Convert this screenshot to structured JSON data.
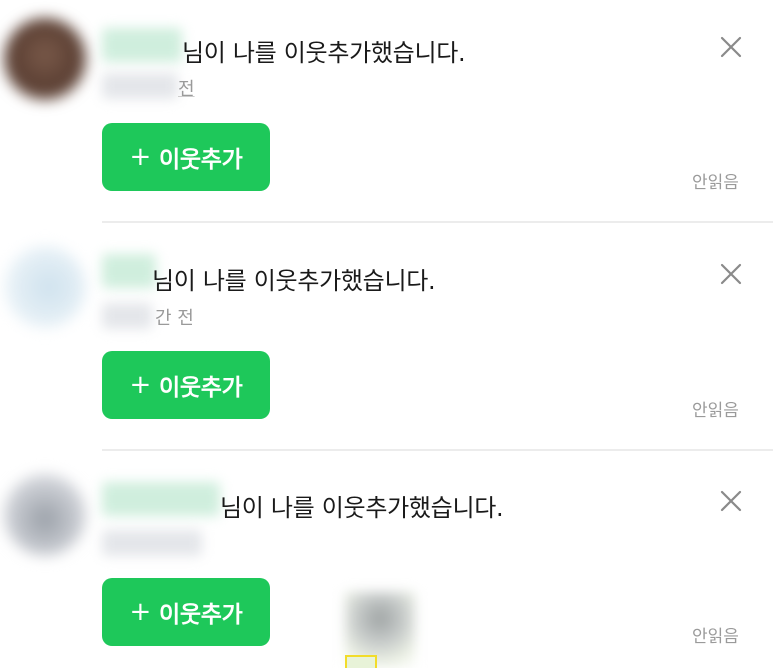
{
  "notifications": [
    {
      "message": "님이 나를 이웃추가했습니다.",
      "time_visible": "전",
      "add_button_label": "이웃추가",
      "add_button_plus": "+",
      "unread_label": "안읽음"
    },
    {
      "message": "님이 나를 이웃추가했습니다.",
      "time_visible": "간 전",
      "add_button_label": "이웃추가",
      "add_button_plus": "+",
      "unread_label": "안읽음"
    },
    {
      "message": "님이 나를 이웃추가했습니다.",
      "time_visible": "",
      "add_button_label": "이웃추가",
      "add_button_plus": "+",
      "unread_label": "안읽음"
    }
  ],
  "colors": {
    "add_button_bg": "#1ec85a",
    "add_button_text": "#ffffff",
    "message_text": "#1a1a1a",
    "meta_text": "#9a9a9a",
    "divider": "#ececec"
  },
  "icons": {
    "close": "close-icon",
    "plus": "plus-icon"
  }
}
